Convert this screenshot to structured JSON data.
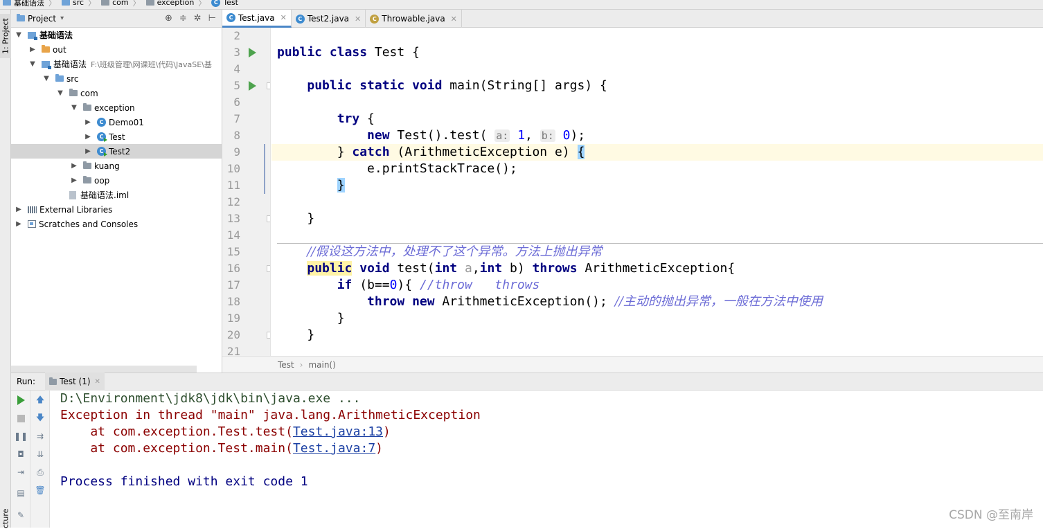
{
  "breadcrumb": [
    "基础语法",
    "src",
    "com",
    "exception",
    "Test"
  ],
  "left_strip": {
    "project_tab": "1: Project",
    "structure_tab": "cture"
  },
  "project_panel": {
    "title": "Project",
    "tree": [
      {
        "label": "基础语法",
        "path": "",
        "level": 0,
        "expanded": true,
        "icon": "module-icon",
        "bold": true
      },
      {
        "label": "out",
        "path": "",
        "level": 1,
        "expanded": false,
        "icon": "folder-orange-icon"
      },
      {
        "label": "基础语法",
        "path": "F:\\班级管理\\网课班\\代码\\JavaSE\\基",
        "level": 1,
        "expanded": true,
        "icon": "module-icon"
      },
      {
        "label": "src",
        "path": "",
        "level": 2,
        "expanded": true,
        "icon": "folder-blue-icon"
      },
      {
        "label": "com",
        "path": "",
        "level": 3,
        "expanded": true,
        "icon": "package-icon"
      },
      {
        "label": "exception",
        "path": "",
        "level": 4,
        "expanded": true,
        "icon": "package-icon"
      },
      {
        "label": "Demo01",
        "path": "",
        "level": 5,
        "expanded": false,
        "icon": "class-icon"
      },
      {
        "label": "Test",
        "path": "",
        "level": 5,
        "expanded": false,
        "icon": "class-icon"
      },
      {
        "label": "Test2",
        "path": "",
        "level": 5,
        "expanded": false,
        "icon": "class-icon",
        "selected": true
      },
      {
        "label": "kuang",
        "path": "",
        "level": 4,
        "expanded": false,
        "icon": "package-icon"
      },
      {
        "label": "oop",
        "path": "",
        "level": 4,
        "expanded": false,
        "icon": "package-icon"
      },
      {
        "label": "基础语法.iml",
        "path": "",
        "level": 3,
        "leaf": true,
        "icon": "iml-file-icon"
      },
      {
        "label": "External Libraries",
        "path": "",
        "level": 0,
        "expanded": false,
        "icon": "libraries-icon"
      },
      {
        "label": "Scratches and Consoles",
        "path": "",
        "level": 0,
        "expanded": false,
        "icon": "scratches-icon"
      }
    ]
  },
  "editor_tabs": [
    {
      "label": "Test.java",
      "active": true
    },
    {
      "label": "Test2.java",
      "active": false
    },
    {
      "label": "Throwable.java",
      "active": false
    }
  ],
  "editor": {
    "line_numbers": [
      "2",
      "3",
      "4",
      "5",
      "6",
      "7",
      "8",
      "9",
      "10",
      "11",
      "12",
      "13",
      "14",
      "15",
      "16",
      "17",
      "18",
      "19",
      "20",
      "21"
    ],
    "hints": {
      "a": "a:",
      "b": "b:",
      "a2": "a"
    },
    "breadcrumb": [
      "Test",
      "main()"
    ]
  },
  "run_panel": {
    "label": "Run:",
    "tab": "Test (1)",
    "console": {
      "cmd": "D:\\Environment\\jdk8\\jdk\\bin\\java.exe ...",
      "exception": "Exception in thread \"main\" java.lang.ArithmeticException",
      "trace1_prefix": "    at com.exception.Test.test(",
      "trace1_link": "Test.java:13",
      "trace2_prefix": "    at com.exception.Test.main(",
      "trace2_link": "Test.java:7",
      "close_paren": ")",
      "finished": "Process finished with exit code 1"
    }
  },
  "watermark": "CSDN @至南岸",
  "colors": {
    "keyword": "#000080",
    "number": "#0000ff",
    "comment": "#6b6bd6",
    "error": "#8b0000",
    "link": "#1a3fa3"
  }
}
